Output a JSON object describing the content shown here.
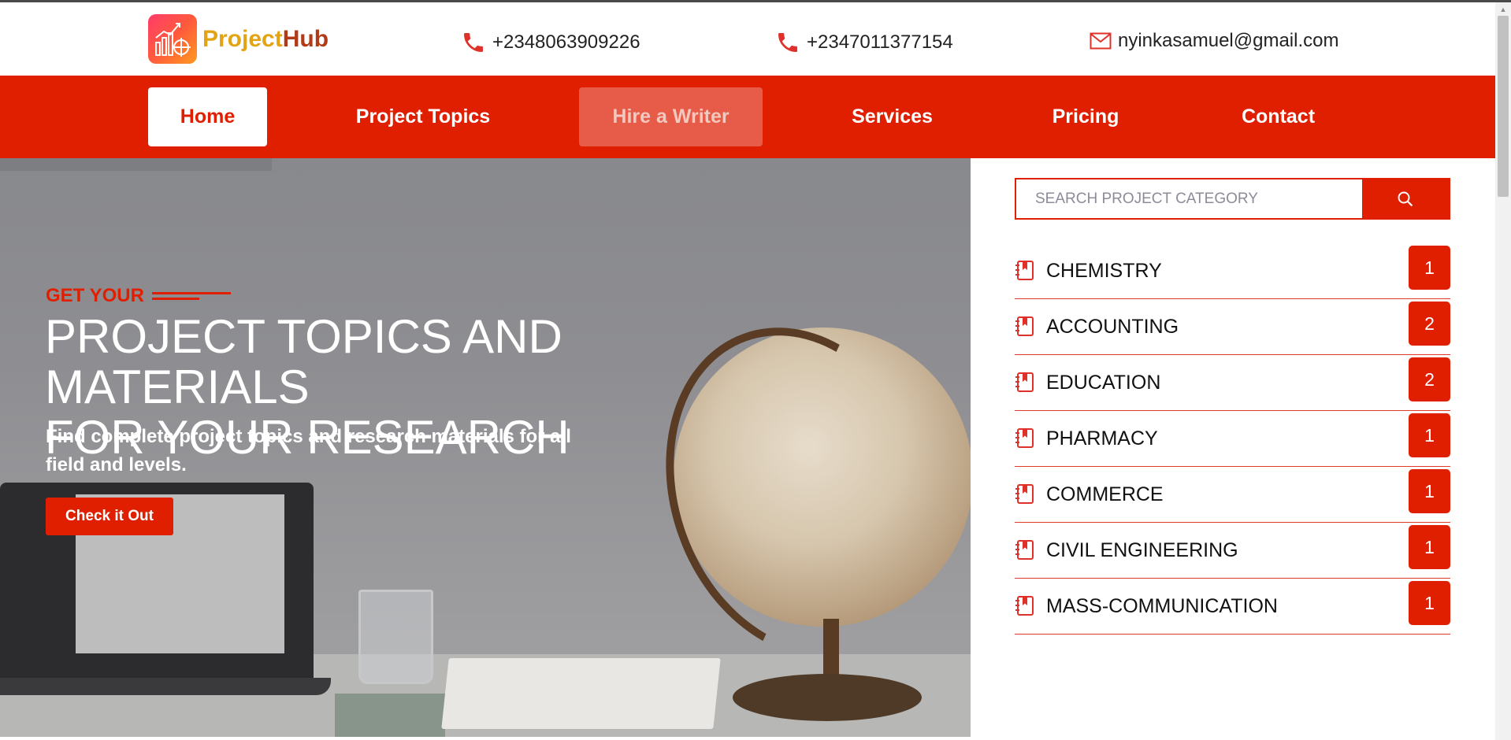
{
  "brand": {
    "name_part1": "Project",
    "name_part2": "Hub",
    "logo_icon": "chart-icon",
    "colors": {
      "primary": "#df1f00",
      "logo_gold": "#e2a412",
      "logo_brown": "#b23a16"
    }
  },
  "contacts": {
    "phone1": "+2348063909226",
    "phone2": "+2347011377154",
    "email": "nyinkasamuel@gmail.com"
  },
  "nav": {
    "items": [
      {
        "label": "Home",
        "state": "active"
      },
      {
        "label": "Project Topics",
        "state": "normal"
      },
      {
        "label": "Hire a Writer",
        "state": "hover"
      },
      {
        "label": "Services",
        "state": "normal"
      },
      {
        "label": "Pricing",
        "state": "normal"
      },
      {
        "label": "Contact",
        "state": "normal"
      }
    ]
  },
  "hero": {
    "kicker": "GET YOUR",
    "title_line1": "PROJECT TOPICS AND MATERIALS",
    "title_line2": "FOR YOUR RESEARCH",
    "subtitle": "Find complete project topics and research materials for all field and levels.",
    "cta_label": "Check it Out"
  },
  "sidebar": {
    "search_placeholder": "SEARCH PROJECT CATEGORY",
    "categories": [
      {
        "label": "CHEMISTRY",
        "count": "1"
      },
      {
        "label": "ACCOUNTING",
        "count": "2"
      },
      {
        "label": "EDUCATION",
        "count": "2"
      },
      {
        "label": "PHARMACY",
        "count": "1"
      },
      {
        "label": "COMMERCE",
        "count": "1"
      },
      {
        "label": "CIVIL ENGINEERING",
        "count": "1"
      },
      {
        "label": "MASS-COMMUNICATION",
        "count": "1"
      }
    ]
  }
}
